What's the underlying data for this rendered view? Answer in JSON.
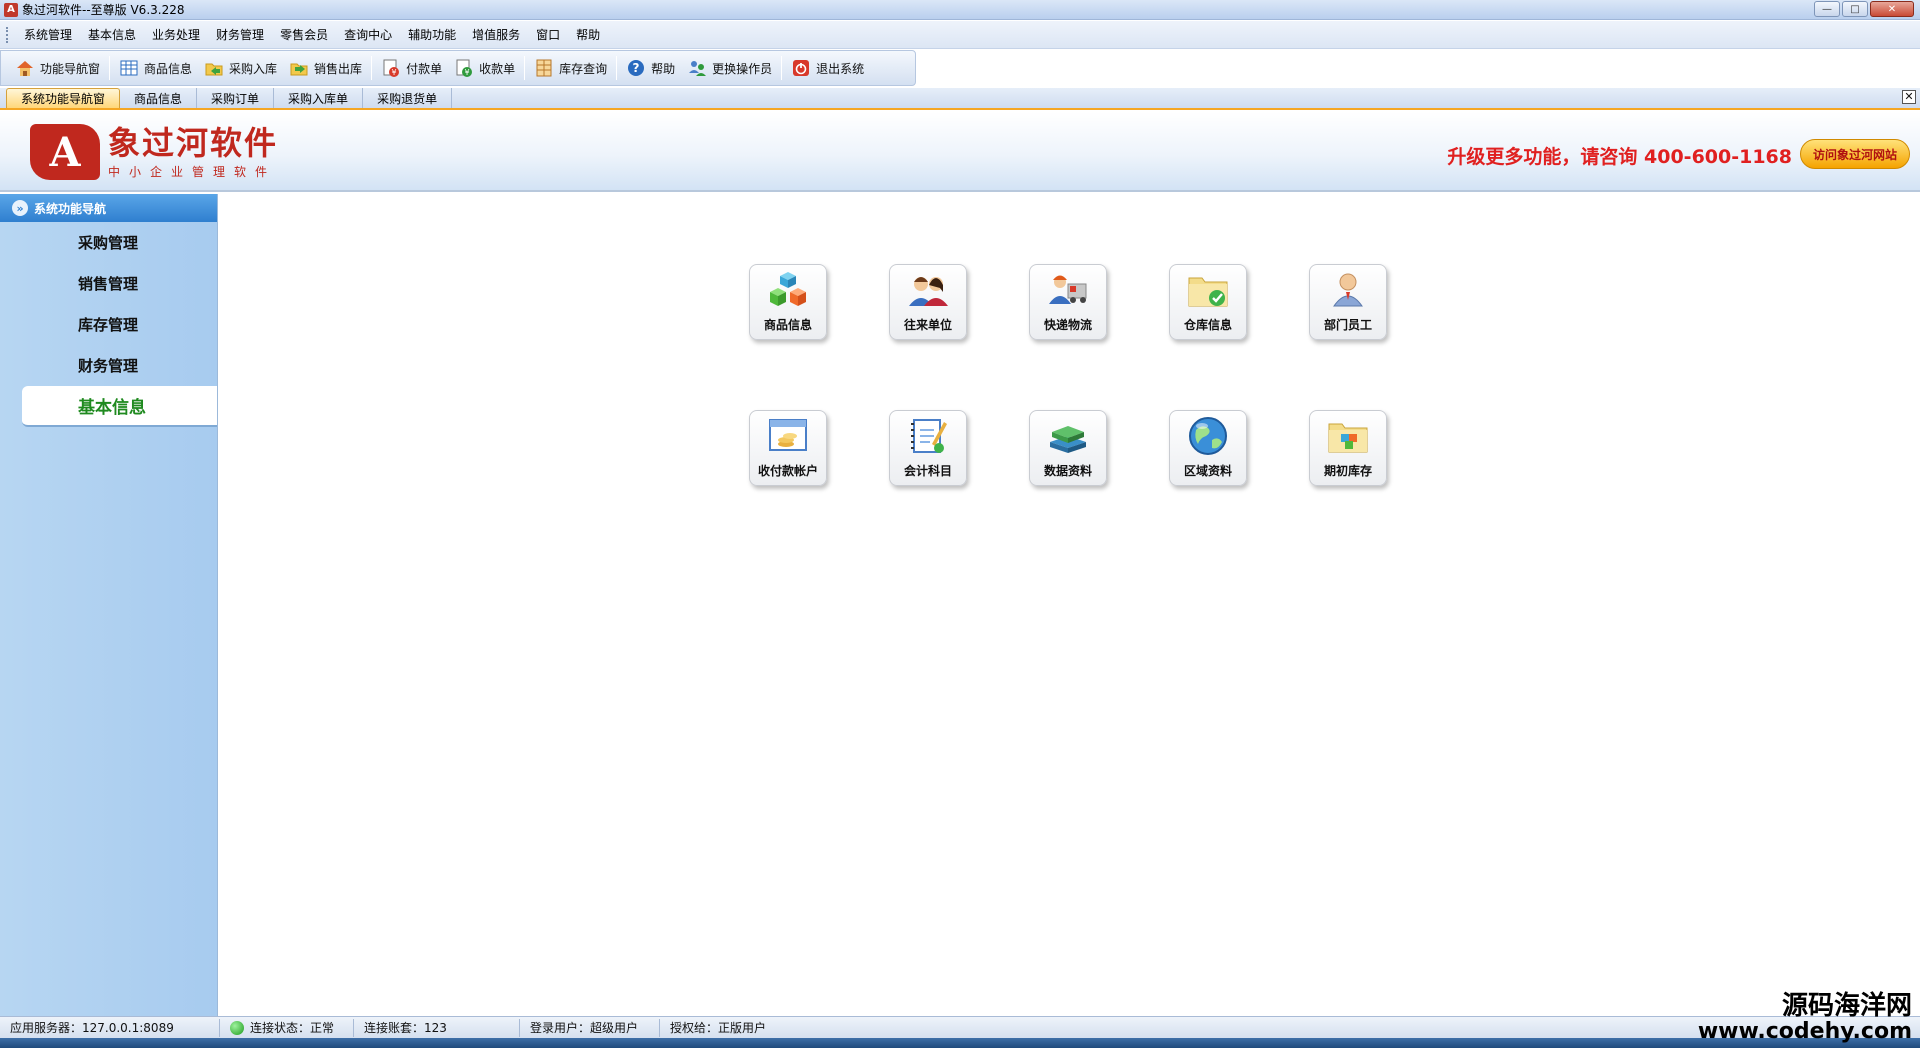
{
  "window": {
    "title": "象过河软件--至尊版 V6.3.228",
    "logo_letter": "A"
  },
  "menu": [
    "系统管理",
    "基本信息",
    "业务处理",
    "财务管理",
    "零售会员",
    "查询中心",
    "辅助功能",
    "增值服务",
    "窗口",
    "帮助"
  ],
  "toolbar": [
    {
      "label": "功能导航窗",
      "icon": "home-icon"
    },
    {
      "label": "商品信息",
      "icon": "grid-icon"
    },
    {
      "label": "采购入库",
      "icon": "folder-in-icon"
    },
    {
      "label": "销售出库",
      "icon": "folder-out-icon"
    },
    {
      "label": "付款单",
      "icon": "payment-icon"
    },
    {
      "label": "收款单",
      "icon": "receipt-icon"
    },
    {
      "label": "库存查询",
      "icon": "inventory-icon"
    },
    {
      "label": "帮助",
      "icon": "help-icon"
    },
    {
      "label": "更换操作员",
      "icon": "switch-user-icon"
    },
    {
      "label": "退出系统",
      "icon": "power-icon"
    }
  ],
  "tabs": [
    "系统功能导航窗",
    "商品信息",
    "采购订单",
    "采购入库单",
    "采购退货单"
  ],
  "banner": {
    "brand_name": "象过河软件",
    "brand_sub": "中小企业管理软件",
    "promo": "升级更多功能，请咨询 400-600-1168",
    "visit_button": "访问象过河网站"
  },
  "sidebar": {
    "header": "系统功能导航",
    "items": [
      "采购管理",
      "销售管理",
      "库存管理",
      "财务管理",
      "基本信息"
    ],
    "active": "基本信息"
  },
  "tiles": [
    {
      "label": "商品信息",
      "icon": "cubes-icon"
    },
    {
      "label": "往来单位",
      "icon": "contacts-icon"
    },
    {
      "label": "快递物流",
      "icon": "courier-icon"
    },
    {
      "label": "仓库信息",
      "icon": "warehouse-folder-icon"
    },
    {
      "label": "部门员工",
      "icon": "employee-icon"
    },
    {
      "label": "收付款帐户",
      "icon": "account-icon"
    },
    {
      "label": "会计科目",
      "icon": "ledger-icon"
    },
    {
      "label": "数据资料",
      "icon": "books-icon"
    },
    {
      "label": "区域资料",
      "icon": "globe-icon"
    },
    {
      "label": "期初库存",
      "icon": "stock-folder-icon"
    }
  ],
  "status": {
    "server": "应用服务器：127.0.0.1:8089",
    "connection": "连接状态：正常",
    "account_set": "连接账套：123",
    "user": "登录用户：超级用户",
    "license": "授权给：正版用户"
  },
  "watermark": {
    "name": "源码海洋网",
    "url": "www.codehy.com"
  }
}
